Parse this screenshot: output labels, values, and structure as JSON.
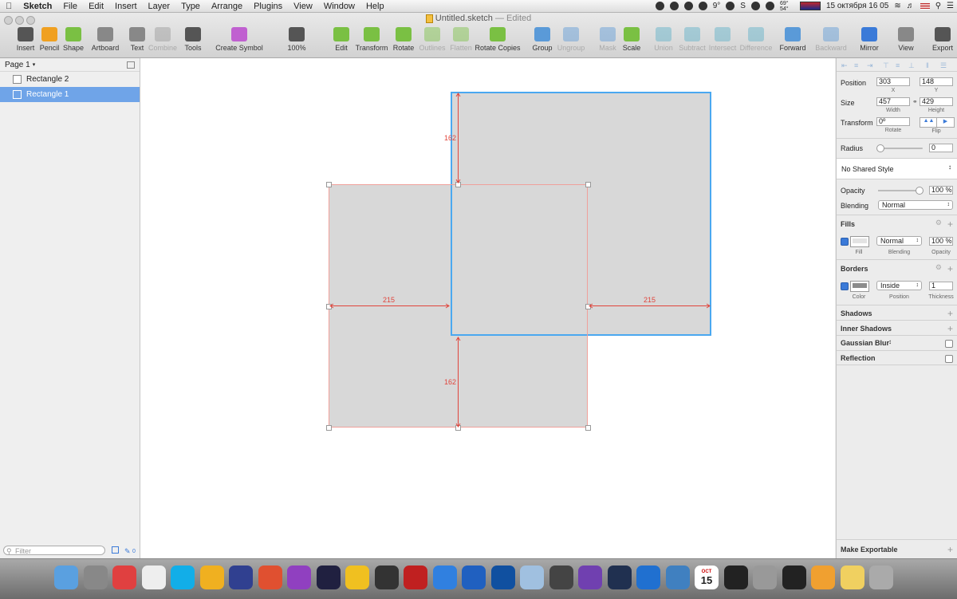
{
  "menubar": {
    "app": "Sketch",
    "items": [
      "File",
      "Edit",
      "Insert",
      "Layer",
      "Type",
      "Arrange",
      "Plugins",
      "View",
      "Window",
      "Help"
    ],
    "temperature": "9°",
    "fan": "S",
    "temps": "69° 54°",
    "datetime": "15 октября 16 05"
  },
  "window": {
    "title": "Untitled.sketch",
    "status": "— Edited"
  },
  "toolbar": {
    "items": [
      {
        "label": "Insert",
        "icon": "plus-icon",
        "enabled": true
      },
      {
        "label": "Pencil",
        "icon": "pencil-icon",
        "enabled": true
      },
      {
        "label": "Shape",
        "icon": "shape-icon",
        "enabled": true
      },
      {
        "label": "Artboard",
        "icon": "artboard-icon",
        "enabled": true
      },
      {
        "label": "Text",
        "icon": "text-icon",
        "enabled": true
      },
      {
        "label": "Combine",
        "icon": "combine-icon",
        "enabled": false
      },
      {
        "label": "Tools",
        "icon": "tools-icon",
        "enabled": true
      },
      {
        "label": "Create Symbol",
        "icon": "symbol-icon",
        "enabled": true
      },
      {
        "label": "100%",
        "icon": "zoom-icon",
        "enabled": true
      },
      {
        "label": "Edit",
        "icon": "edit-icon",
        "enabled": true
      },
      {
        "label": "Transform",
        "icon": "transform-icon",
        "enabled": true
      },
      {
        "label": "Rotate",
        "icon": "rotate-icon",
        "enabled": true
      },
      {
        "label": "Outlines",
        "icon": "outlines-icon",
        "enabled": false
      },
      {
        "label": "Flatten",
        "icon": "flatten-icon",
        "enabled": false
      },
      {
        "label": "Rotate Copies",
        "icon": "rotate-copies-icon",
        "enabled": true
      },
      {
        "label": "Group",
        "icon": "group-icon",
        "enabled": true
      },
      {
        "label": "Ungroup",
        "icon": "ungroup-icon",
        "enabled": false
      },
      {
        "label": "Mask",
        "icon": "mask-icon",
        "enabled": false
      },
      {
        "label": "Scale",
        "icon": "scale-icon",
        "enabled": true
      },
      {
        "label": "Union",
        "icon": "union-icon",
        "enabled": false
      },
      {
        "label": "Subtract",
        "icon": "subtract-icon",
        "enabled": false
      },
      {
        "label": "Intersect",
        "icon": "intersect-icon",
        "enabled": false
      },
      {
        "label": "Difference",
        "icon": "difference-icon",
        "enabled": false
      },
      {
        "label": "Forward",
        "icon": "forward-icon",
        "enabled": true
      },
      {
        "label": "Backward",
        "icon": "backward-icon",
        "enabled": false
      },
      {
        "label": "Mirror",
        "icon": "mirror-icon",
        "enabled": true
      },
      {
        "label": "View",
        "icon": "view-icon",
        "enabled": true
      },
      {
        "label": "Export",
        "icon": "export-icon",
        "enabled": true
      }
    ]
  },
  "sidebar": {
    "page": "Page 1",
    "layers": [
      {
        "name": "Rectangle 2",
        "selected": false
      },
      {
        "name": "Rectangle 1",
        "selected": true
      }
    ],
    "filter_placeholder": "Filter",
    "count": "0"
  },
  "canvas": {
    "measure_top": "162",
    "measure_bottom": "162",
    "measure_left": "215",
    "measure_right": "215",
    "accent": "#4aa8f0",
    "measure_color": "#e0453c",
    "fill_color": "#d8d8d8"
  },
  "inspector": {
    "position_label": "Position",
    "x": "303",
    "x_label": "X",
    "y": "148",
    "y_label": "Y",
    "size_label": "Size",
    "width": "457",
    "width_label": "Width",
    "height": "429",
    "height_label": "Height",
    "transform_label": "Transform",
    "rotate": "0º",
    "rotate_label": "Rotate",
    "flip_label": "Flip",
    "radius_label": "Radius",
    "radius": "0",
    "shared_style": "No Shared Style",
    "opacity_label": "Opacity",
    "opacity": "100 %",
    "blending_label": "Blending",
    "blending": "Normal",
    "fills_title": "Fills",
    "fill_label": "Fill",
    "fill_blending": "Normal",
    "fill_blending_label": "Blending",
    "fill_opacity": "100 %",
    "fill_opacity_label": "Opacity",
    "borders_title": "Borders",
    "border_color_label": "Color",
    "border_position": "Inside",
    "border_position_label": "Position",
    "border_thickness": "1",
    "border_thickness_label": "Thickness",
    "shadows": "Shadows",
    "inner_shadows": "Inner Shadows",
    "blur": "Gaussian Blur",
    "reflection": "Reflection",
    "make_exportable": "Make Exportable"
  },
  "dock": {
    "apps": [
      "finder-icon",
      "launchpad-icon",
      "chrome-icon",
      "clock-icon",
      "skype-icon",
      "sketch-icon",
      "prism-icon",
      "folder-icon",
      "screen-icon",
      "colorful-icon",
      "pencil-app-icon",
      "pen-icon",
      "pdf-icon",
      "itunes-icon",
      "quicktime-icon",
      "search-app-icon",
      "gemini-icon",
      "joystick-icon",
      "viber-icon",
      "steam-icon",
      "appstore-icon",
      "xcode-icon",
      "calendar-icon",
      "terminal-icon",
      "settings-icon",
      "activity-icon",
      "pages-icon",
      "notes-icon",
      "trash-icon"
    ],
    "calendar_day": "15",
    "calendar_month": "OCT"
  }
}
